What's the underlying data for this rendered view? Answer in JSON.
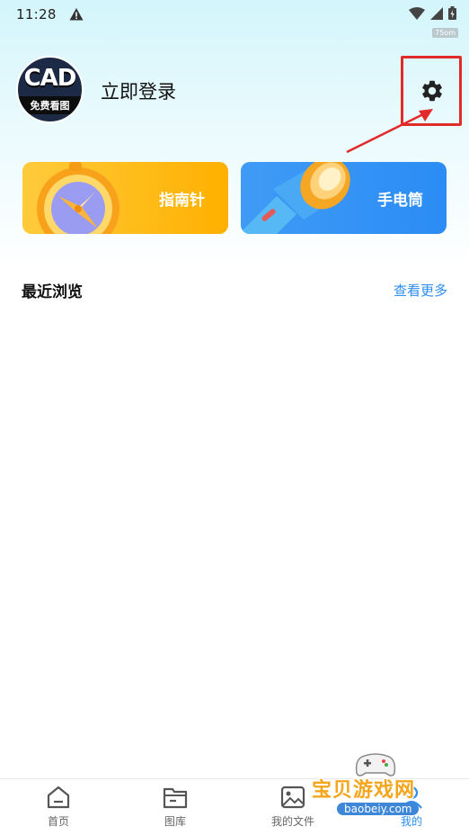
{
  "status_bar": {
    "time": "11:28",
    "net_speed": "75om"
  },
  "profile": {
    "avatar_text": "CAD",
    "avatar_subtext": "免费看图",
    "login_label": "立即登录"
  },
  "tools": [
    {
      "label": "指南针",
      "icon": "compass-icon"
    },
    {
      "label": "手电筒",
      "icon": "flashlight-icon"
    }
  ],
  "recent": {
    "title": "最近浏览",
    "more_label": "查看更多"
  },
  "bottom_nav": [
    {
      "label": "首页",
      "icon": "home-icon"
    },
    {
      "label": "图库",
      "icon": "folder-icon"
    },
    {
      "label": "我的文件",
      "icon": "image-icon"
    },
    {
      "label": "我的",
      "icon": "profile-icon",
      "active": true
    }
  ],
  "watermark": {
    "text": "宝贝游戏网",
    "url": "baobeiy.com"
  },
  "colors": {
    "accent": "#2b8ef0",
    "highlight": "#e12a2a",
    "compass_card": "#ffb000",
    "torch_card": "#2b8cf5"
  }
}
